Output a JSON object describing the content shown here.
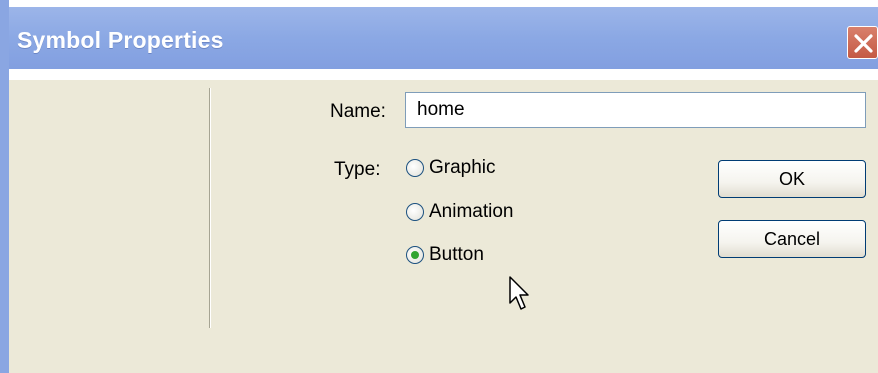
{
  "window": {
    "title": "Symbol Properties",
    "close_icon": "close-icon"
  },
  "form": {
    "name_label": "Name:",
    "name_value": "home",
    "type_label": "Type:",
    "type_options": [
      {
        "label": "Graphic",
        "checked": false
      },
      {
        "label": "Animation",
        "checked": false
      },
      {
        "label": "Button",
        "checked": true
      }
    ]
  },
  "buttons": {
    "ok_label": "OK",
    "cancel_label": "Cancel"
  },
  "colors": {
    "titlebar": "#8ba8e4",
    "close_button": "#c45a45",
    "dialog_face": "#ece9d8",
    "radio_selected": "#31a531"
  }
}
